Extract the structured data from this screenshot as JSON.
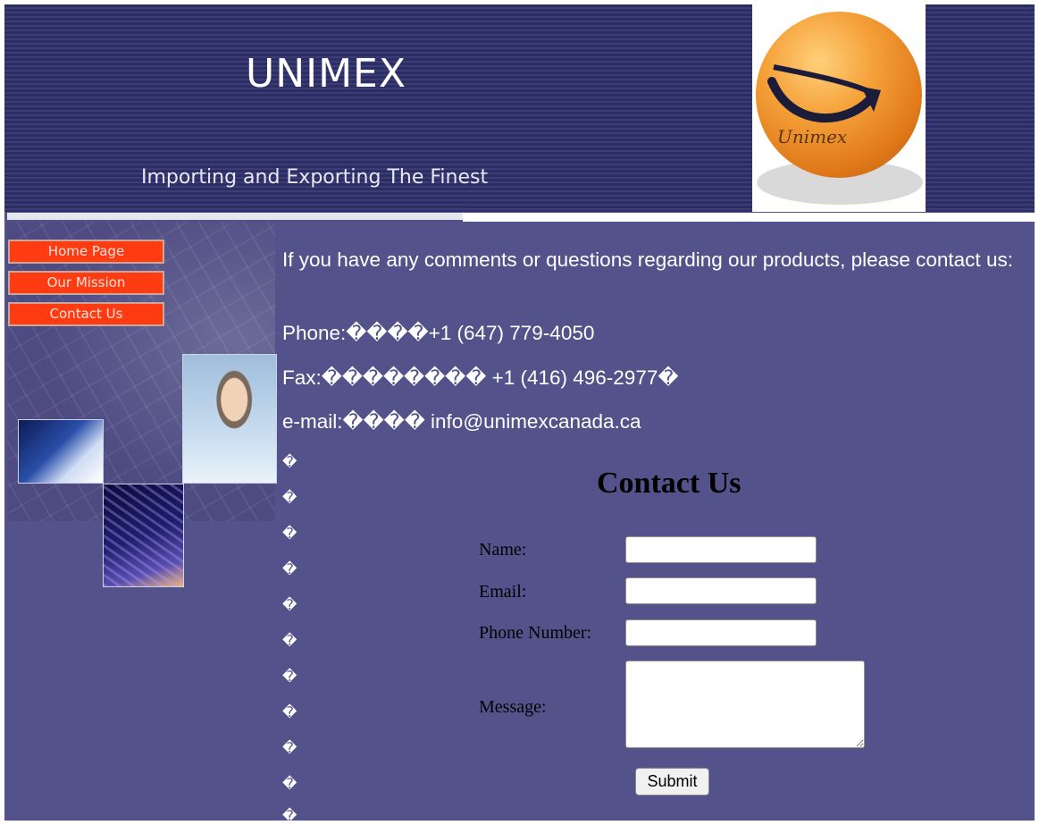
{
  "header": {
    "title": "UNIMEX",
    "subtitle": "Importing and Exporting The Finest",
    "logo_text": "Unimex"
  },
  "nav": {
    "items": [
      {
        "label": "Home Page"
      },
      {
        "label": "Our Mission"
      },
      {
        "label": "Contact Us"
      }
    ]
  },
  "contact": {
    "intro": "If you have any comments or questions regarding our products, please contact us:",
    "phone": "Phone:����+1 (647) 779-4050",
    "fax": "Fax:�������� +1 (416) 496-2977�",
    "email": "e-mail:���� info@unimexcanada.ca",
    "filler": "�"
  },
  "form": {
    "title": "Contact Us",
    "name_label": "Name:",
    "email_label": "Email:",
    "phone_label": "Phone Number:",
    "message_label": "Message:",
    "name_value": "",
    "email_value": "",
    "phone_value": "",
    "message_value": "",
    "submit_label": "Submit"
  },
  "colors": {
    "background": "#54528a",
    "banner": "#2c2d63",
    "nav_button": "#ff3b11"
  }
}
